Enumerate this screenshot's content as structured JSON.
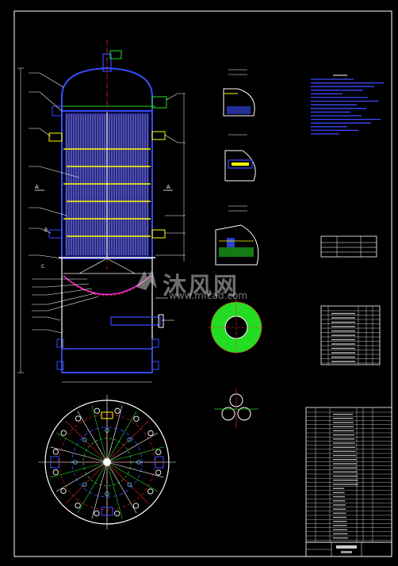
{
  "watermark": {
    "brand_text": "沐风网",
    "url_text": "www.mfcad.com"
  },
  "section_marks": {
    "left_A": "A",
    "right_A": "A",
    "left_B": "B",
    "left_C": "C"
  },
  "colors": {
    "background": "#000000",
    "outline": "#ffffff",
    "blue": "#3a4cff",
    "yellow": "#ffff00",
    "red": "#ff2020",
    "green": "#22dd22",
    "magenta": "#ff33ff",
    "cyan": "#33e0ff"
  }
}
